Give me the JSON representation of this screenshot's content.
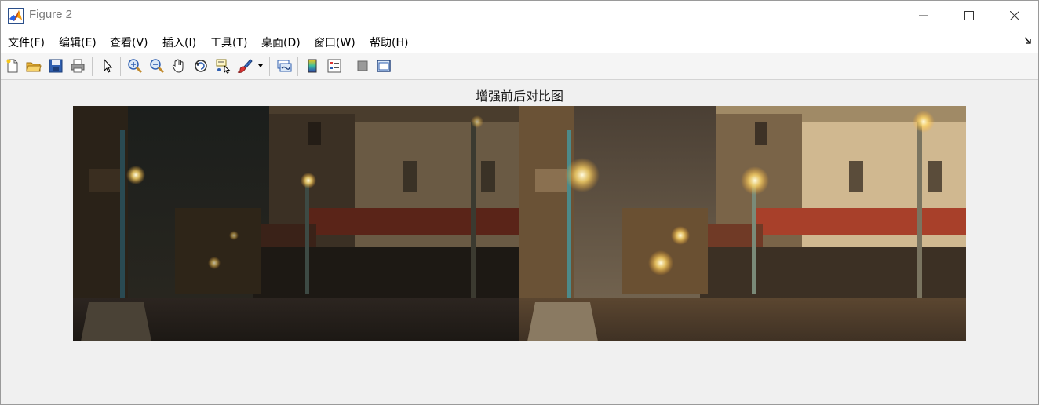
{
  "window": {
    "title": "Figure 2"
  },
  "menu": {
    "items": [
      {
        "label": "文件(F)"
      },
      {
        "label": "编辑(E)"
      },
      {
        "label": "查看(V)"
      },
      {
        "label": "插入(I)"
      },
      {
        "label": "工具(T)"
      },
      {
        "label": "桌面(D)"
      },
      {
        "label": "窗口(W)"
      },
      {
        "label": "帮助(H)"
      }
    ]
  },
  "toolbar": {
    "buttons": [
      {
        "icon": "new-figure-icon"
      },
      {
        "icon": "open-file-icon"
      },
      {
        "icon": "save-icon"
      },
      {
        "icon": "print-icon"
      },
      {
        "icon": "pointer-icon"
      },
      {
        "icon": "zoom-in-icon"
      },
      {
        "icon": "zoom-out-icon"
      },
      {
        "icon": "pan-hand-icon"
      },
      {
        "icon": "rotate-3d-icon"
      },
      {
        "icon": "data-cursor-icon"
      },
      {
        "icon": "brush-icon"
      },
      {
        "icon": "link-plot-icon"
      },
      {
        "icon": "colorbar-icon"
      },
      {
        "icon": "legend-icon"
      },
      {
        "icon": "hide-plot-tools-icon"
      },
      {
        "icon": "show-plot-tools-icon"
      }
    ]
  },
  "figure": {
    "title": "增强前后对比图",
    "panels": [
      {
        "name": "original-image"
      },
      {
        "name": "enhanced-image"
      }
    ]
  },
  "colors": {
    "background": "#f0f0f0",
    "titlebar": "#ffffff",
    "accent_blue": "#1f5fbf"
  }
}
